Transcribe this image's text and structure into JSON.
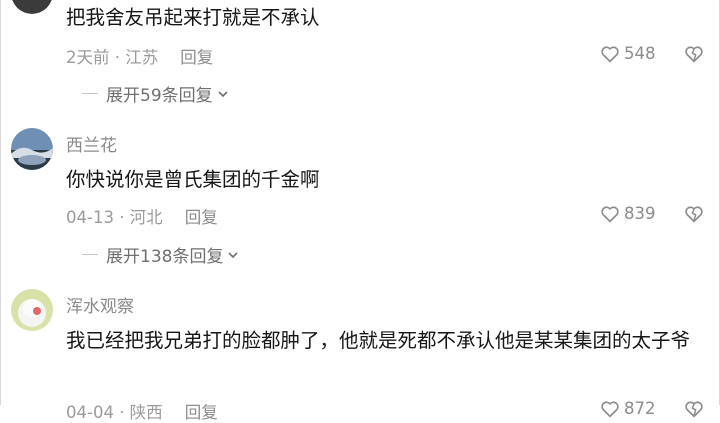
{
  "comments": [
    {
      "username": "",
      "content": "把我舍友吊起来打就是不承认",
      "meta": "2天前 · 江苏",
      "reply_label": "回复",
      "likes": "548",
      "expand_label": "展开59条回复"
    },
    {
      "username": "西兰花",
      "content": "你快说你是曾氏集团的千金啊",
      "meta": "04-13 · 河北",
      "reply_label": "回复",
      "likes": "839",
      "expand_label": "展开138条回复"
    },
    {
      "username": "浑水观察",
      "content": "我已经把我兄弟打的脸都肿了，他就是死都不承认他是某某集团的太子爷",
      "meta": "04-04 · 陕西",
      "reply_label": "回复",
      "likes": "872"
    }
  ],
  "icons": {
    "like": "heart-icon",
    "dislike": "broken-heart-icon",
    "expand": "chevron-down-icon"
  },
  "colors": {
    "text": "#161616",
    "meta": "#9b9b9b",
    "icon": "#8c8c8c"
  }
}
